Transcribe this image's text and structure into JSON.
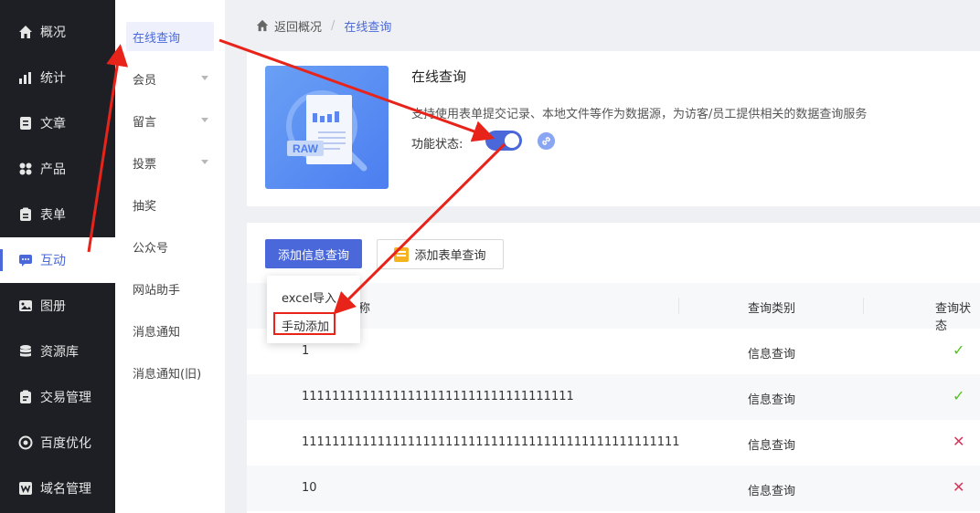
{
  "nav": {
    "items": [
      {
        "label": "概况",
        "icon": "home-icon"
      },
      {
        "label": "统计",
        "icon": "chart-icon"
      },
      {
        "label": "文章",
        "icon": "article-icon"
      },
      {
        "label": "产品",
        "icon": "grid-icon"
      },
      {
        "label": "表单",
        "icon": "form-icon"
      },
      {
        "label": "互动",
        "icon": "chat-icon",
        "active": true
      },
      {
        "label": "图册",
        "icon": "image-icon"
      },
      {
        "label": "资源库",
        "icon": "database-icon"
      },
      {
        "label": "交易管理",
        "icon": "trade-icon"
      },
      {
        "label": "百度优化",
        "icon": "seo-icon"
      },
      {
        "label": "域名管理",
        "icon": "domain-icon"
      }
    ]
  },
  "submenu": {
    "items": [
      {
        "label": "在线查询",
        "active": true
      },
      {
        "label": "会员",
        "expandable": true
      },
      {
        "label": "留言",
        "expandable": true
      },
      {
        "label": "投票",
        "expandable": true
      },
      {
        "label": "抽奖"
      },
      {
        "label": "公众号"
      },
      {
        "label": "网站助手"
      },
      {
        "label": "消息通知"
      },
      {
        "label": "消息通知(旧)"
      }
    ]
  },
  "breadcrumb": {
    "back": "返回概况",
    "separator": "/",
    "current": "在线查询"
  },
  "card": {
    "title": "在线查询",
    "description": "支持使用表单提交记录、本地文件等作为数据源，为访客/员工提供相关的数据查询服务",
    "status_label": "功能状态:",
    "status_on": true,
    "cover_text": "RAW"
  },
  "toolbar": {
    "add_info": "添加信息查询",
    "add_form": "添加表单查询"
  },
  "dropdown": {
    "items": [
      "excel导入",
      "手动添加"
    ]
  },
  "table": {
    "headers": [
      "称",
      "查询类别",
      "查询状态"
    ],
    "rows": [
      {
        "name": "1",
        "type": "信息查询",
        "status": "✓",
        "status_kind": "ok"
      },
      {
        "name": "111111111111111111111111111111111111",
        "type": "信息查询",
        "status": "✓",
        "status_kind": "ok"
      },
      {
        "name": "11111111111111111111111111111111111111111111111111",
        "type": "信息查询",
        "status": "✕",
        "status_kind": "bad"
      },
      {
        "name": "10",
        "type": "信息查询",
        "status": "✕",
        "status_kind": "bad"
      }
    ]
  },
  "colors": {
    "primary": "#4a68d9",
    "sidebar": "#1d1f24",
    "annotation": "#e8231a",
    "ok": "#52c41a",
    "bad": "#d9365b"
  }
}
